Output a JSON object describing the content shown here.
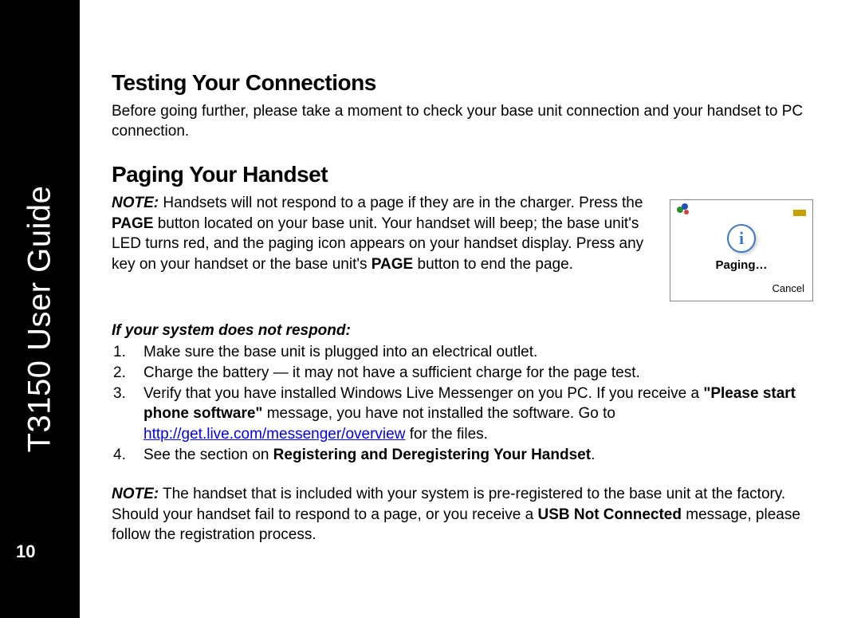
{
  "sidebar": {
    "title": "T3150 User Guide",
    "page_number": "10"
  },
  "section1": {
    "heading": "Testing Your Connections",
    "intro": "Before going further, please take a moment to check your base unit connection and your handset to PC connection."
  },
  "section2": {
    "heading": "Paging Your Handset",
    "note_label": "NOTE:",
    "note_text": " Handsets will not respond to a page if they are in the charger.",
    "body_a": "Press the ",
    "body_page1": "PAGE",
    "body_b": " button located on your base unit. Your handset will beep; the base unit's LED turns red, and the paging icon appears on your handset display. Press any key on your handset or the base unit's ",
    "body_page2": "PAGE",
    "body_c": " button to end the page."
  },
  "screenshot": {
    "paging_label": "Paging…",
    "cancel_label": "Cancel"
  },
  "troubleshoot": {
    "heading": "If your system does not respond:",
    "items": [
      {
        "a": "Make sure the base unit is plugged into an electrical outlet."
      },
      {
        "a": "Charge the battery — it may not have a sufficient charge for the page test."
      },
      {
        "a": "Verify that you have installed Windows Live Messenger on you PC. If you receive a ",
        "bold": "\"Please start phone software\"",
        "b": " message, you have not installed the software. Go to ",
        "link": "http://get.live.com/messenger/overview",
        "c": " for the files."
      },
      {
        "a": "See the section on ",
        "bold": "Registering and Deregistering Your Handset",
        "b": "."
      }
    ]
  },
  "footnote": {
    "note_label": "NOTE:",
    "a": " The handset that is included with your system is pre-registered to the base unit at the factory. Should your handset fail to respond to a page, or you receive a ",
    "bold": "USB Not Connected",
    "b": " message, please follow the registration process."
  }
}
